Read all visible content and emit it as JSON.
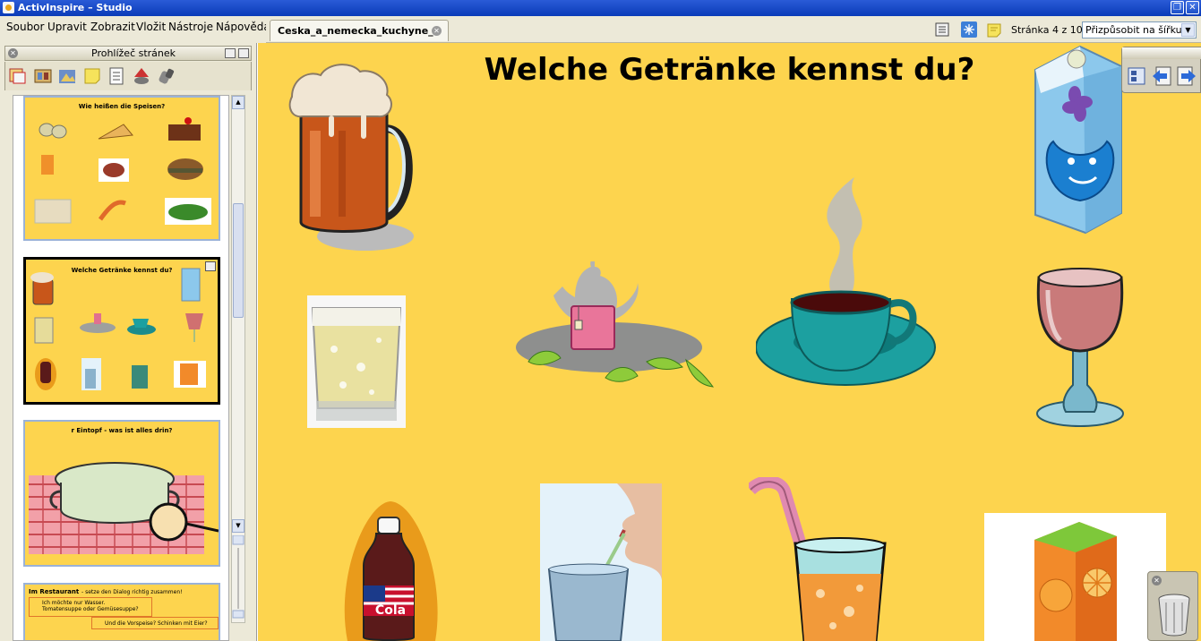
{
  "window": {
    "title": "ActivInspire – Studio"
  },
  "menu": [
    {
      "label": "Soubor"
    },
    {
      "label": "Upravit"
    },
    {
      "label": "Zobrazit"
    },
    {
      "label": "Vložit"
    },
    {
      "label": "Nástroje"
    },
    {
      "label": "Nápověda"
    }
  ],
  "tab": {
    "label": "Ceska_a_nemecka_kuchyne_"
  },
  "toolbar": {
    "page_indicator": "Stránka 4 z 10",
    "zoom": "Přizpůsobit na šířku"
  },
  "page_browser": {
    "title": "Prohlížeč stránek",
    "thumbnails": [
      {
        "title": "Wie heißen die Speisen?"
      },
      {
        "title": "Welche Getränke kennst du?"
      },
      {
        "title": "r Eintopf - was ist alles drin?"
      },
      {
        "title": "Im Restaurant",
        "subtitle": "- setze den Dialog richtig zusammen!",
        "lines": [
          "Ich möchte nur Wasser.",
          "Tomatensuppe oder Gemüsesuppe?",
          "Und die Vorspeise? Schinken mit Eier?"
        ]
      }
    ]
  },
  "canvas": {
    "title": "Welche Getränke kennst du?",
    "cola_label": "Cola"
  },
  "colors": {
    "page_background": "#fdd44e",
    "title_bar": "#0a3bb8",
    "chrome": "#ece9d8"
  }
}
